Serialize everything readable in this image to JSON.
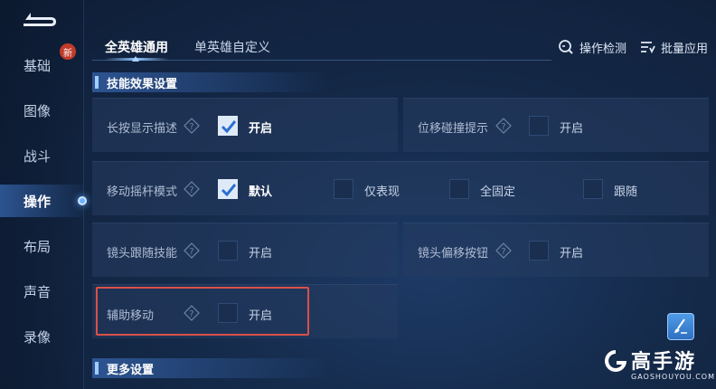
{
  "sidebar": {
    "new_badge": "新",
    "items": [
      {
        "label": "基础"
      },
      {
        "label": "图像"
      },
      {
        "label": "战斗"
      },
      {
        "label": "操作"
      },
      {
        "label": "布局"
      },
      {
        "label": "声音"
      },
      {
        "label": "录像"
      }
    ],
    "active_index": 3
  },
  "tabs": [
    {
      "label": "全英雄通用",
      "active": true
    },
    {
      "label": "单英雄自定义",
      "active": false
    }
  ],
  "top_actions": {
    "detect": "操作检测",
    "batch_apply": "批量应用"
  },
  "sections": {
    "skill_effect": "技能效果设置",
    "more": "更多设置"
  },
  "settings": {
    "long_press_desc": {
      "label": "长按显示描述",
      "option": "开启",
      "checked": true
    },
    "displacement_hint": {
      "label": "位移碰撞提示",
      "option": "开启",
      "checked": false
    },
    "joystick_mode": {
      "label": "移动摇杆模式",
      "options": [
        {
          "label": "默认",
          "checked": true
        },
        {
          "label": "仅表现",
          "checked": false
        },
        {
          "label": "全固定",
          "checked": false
        },
        {
          "label": "跟随",
          "checked": false
        }
      ]
    },
    "camera_follow": {
      "label": "镜头跟随技能",
      "option": "开启",
      "checked": false
    },
    "camera_offset": {
      "label": "镜头偏移按钮",
      "option": "开启",
      "checked": false
    },
    "assist_move": {
      "label": "辅助移动",
      "option": "开启",
      "checked": false
    }
  },
  "watermark": {
    "main": "高手游",
    "sub": "GAOSHOUYOU.COM"
  },
  "colors": {
    "highlight": "#d9504a",
    "accent": "#6fb2ff"
  }
}
